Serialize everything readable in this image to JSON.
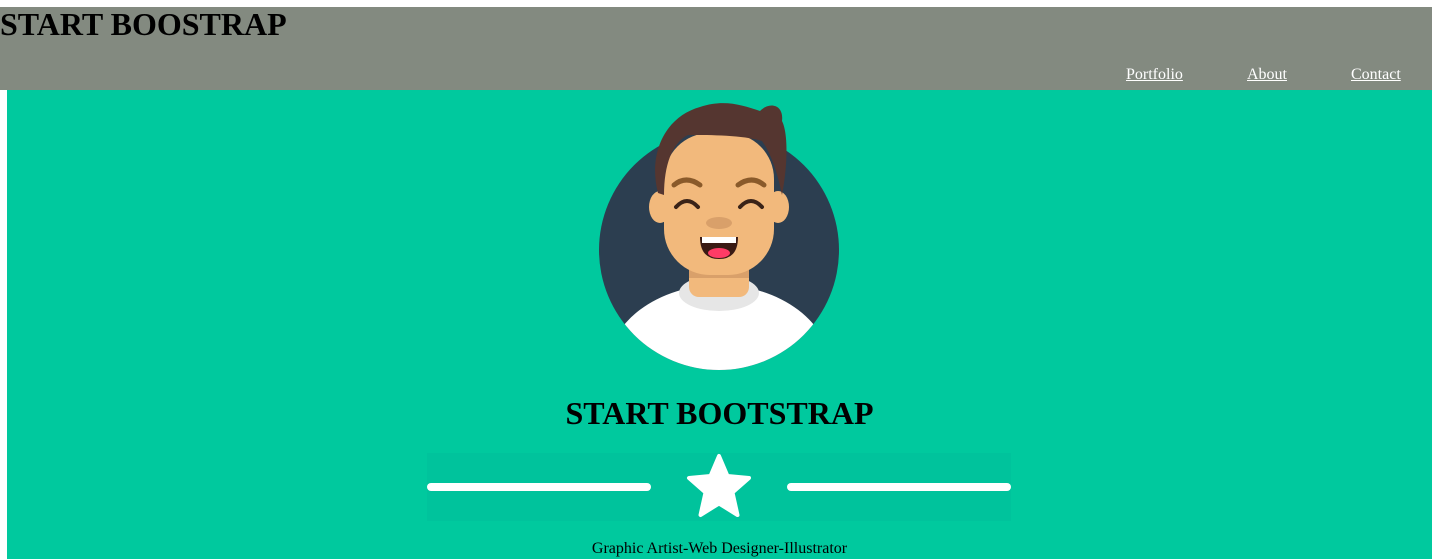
{
  "navbar": {
    "brand": "START BOOSTRAP",
    "links": [
      {
        "label": "Portfolio"
      },
      {
        "label": "About"
      },
      {
        "label": "Contact"
      }
    ]
  },
  "hero": {
    "title": "START BOOTSTRAP",
    "tagline": "Graphic Artist-Web Designer-Illustrator",
    "avatar_icon": "avatar-man-icon",
    "divider_icon": "star-icon"
  },
  "colors": {
    "navbar_bg": "#838a80",
    "hero_bg": "#00c99e",
    "divider_bg": "#00c39c",
    "avatar_circle": "#2c3e50",
    "skin": "#f2b97c",
    "hair": "#553630"
  }
}
